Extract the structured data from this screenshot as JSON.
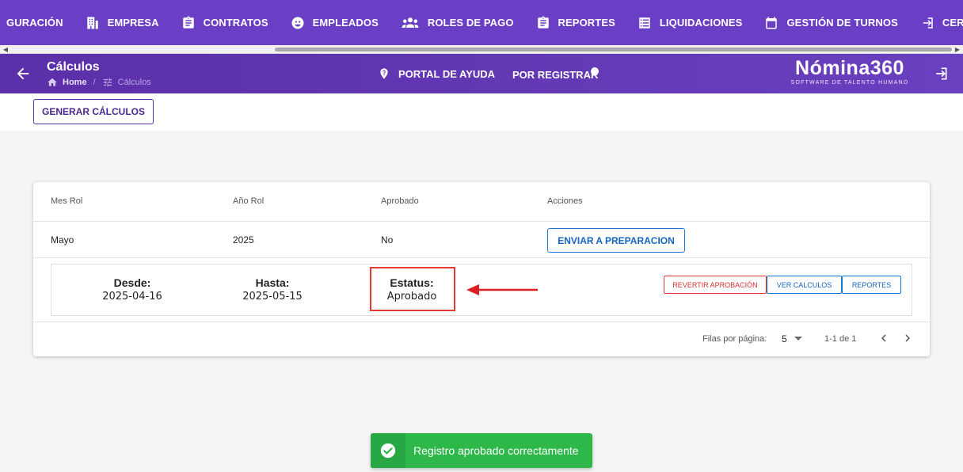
{
  "nav": {
    "items": [
      {
        "label": "GURACIÓN",
        "icon": "none"
      },
      {
        "label": "EMPRESA",
        "icon": "building-icon"
      },
      {
        "label": "CONTRATOS",
        "icon": "clipboard-icon"
      },
      {
        "label": "EMPLEADOS",
        "icon": "face-icon"
      },
      {
        "label": "ROLES DE PAGO",
        "icon": "group-icon"
      },
      {
        "label": "REPORTES",
        "icon": "clipboard-icon"
      },
      {
        "label": "LIQUIDACIONES",
        "icon": "list-icon"
      },
      {
        "label": "GESTIÓN DE TURNOS",
        "icon": "calendar-icon"
      },
      {
        "label": "CERRAR SESIÓN",
        "icon": "logout-icon"
      }
    ]
  },
  "header": {
    "title": "Cálculos",
    "breadcrumb_home": "Home",
    "breadcrumb_sep": "/",
    "breadcrumb_current": "Cálculos",
    "help_label": "PORTAL DE AYUDA",
    "register_label": "POR REGISTRAR",
    "logo_name": "Nómina360",
    "logo_tagline": "SOFTWARE DE TALENTO HUMANO"
  },
  "toolbar": {
    "generate_label": "GENERAR CÁLCULOS"
  },
  "table": {
    "headers": [
      "Mes Rol",
      "Año Rol",
      "Aprobado",
      "Acciones"
    ],
    "row": {
      "mes": "Mayo",
      "anio": "2025",
      "aprobado": "No",
      "action_label": "ENVIAR A PREPARACION"
    },
    "detail": {
      "desde_label": "Desde:",
      "desde_value": "2025-04-16",
      "hasta_label": "Hasta:",
      "hasta_value": "2025-05-15",
      "estatus_label": "Estatus:",
      "estatus_value": "Aprobado",
      "revert_label": "REVERTIR APROBACIÓN",
      "ver_label": "VER CALCULOS",
      "reportes_label": "REPORTES"
    },
    "footer": {
      "rows_per_page_label": "Filas por página:",
      "rows_per_page": "5",
      "range": "1-1 de 1"
    }
  },
  "toast": {
    "message": "Registro aprobado correctamente"
  },
  "colors": {
    "primary": "#6a3fc5",
    "accent_red": "#e53935",
    "accent_blue": "#1976d2",
    "success": "#2eb84a"
  }
}
